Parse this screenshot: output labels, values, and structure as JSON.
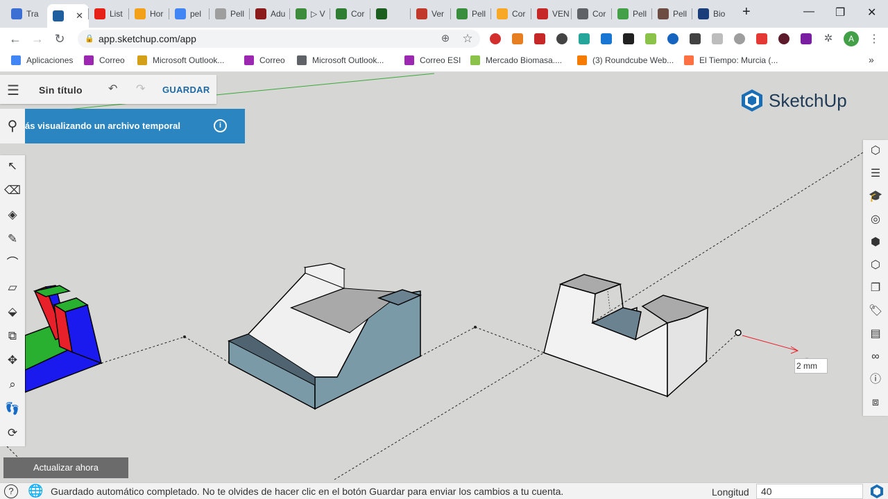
{
  "browser": {
    "tabs": [
      {
        "label": "Tra",
        "color": "#3b6fd4"
      },
      {
        "label": "",
        "color": "#1f5fa0",
        "active": true
      },
      {
        "label": "List",
        "color": "#e62117"
      },
      {
        "label": "Hor",
        "color": "#f4a11a"
      },
      {
        "label": "pel",
        "color": "#4285f4"
      },
      {
        "label": "Pell",
        "color": "#9e9e9e"
      },
      {
        "label": "Adu",
        "color": "#8b1a1a"
      },
      {
        "label": "▷ V",
        "color": "#3c8c3c"
      },
      {
        "label": "Cor",
        "color": "#2e7d32"
      },
      {
        "label": "",
        "color": "#1b5e20"
      },
      {
        "label": "Ver",
        "color": "#c0392b"
      },
      {
        "label": "Pell",
        "color": "#388e3c"
      },
      {
        "label": "Cor",
        "color": "#f9a825"
      },
      {
        "label": "VEN",
        "color": "#c62828"
      },
      {
        "label": "Cor",
        "color": "#5f6368"
      },
      {
        "label": "Pell",
        "color": "#43a047"
      },
      {
        "label": "Pell",
        "color": "#6d4c41"
      },
      {
        "label": "Bio",
        "color": "#1a3e7a"
      }
    ],
    "new_tab": "+",
    "url": "app.sketchup.com/app",
    "bookmarks": [
      {
        "label": "Aplicaciones",
        "color": "#4285f4"
      },
      {
        "label": "Correo",
        "color": "#9c27b0"
      },
      {
        "label": "Microsoft Outlook...",
        "color": "#d4a017"
      },
      {
        "label": "Correo",
        "color": "#9c27b0"
      },
      {
        "label": "Microsoft Outlook...",
        "color": "#5f6368"
      },
      {
        "label": "Correo ESI",
        "color": "#9c27b0"
      },
      {
        "label": "Mercado Biomasa....",
        "color": "#8bc34a"
      },
      {
        "label": "(3) Roundcube Web...",
        "color": "#f57c00"
      },
      {
        "label": "El Tiempo: Murcia (...",
        "color": "#ff7043"
      }
    ],
    "bookmarks_more": "»",
    "profile_initial": "A"
  },
  "app": {
    "title": "Sin título",
    "save_label": "GUARDAR",
    "banner_text": "ás visualizando un archivo temporal",
    "logo_text": "SketchUp",
    "update_label": "Actualizar ahora",
    "dimension_label": "2 mm",
    "status": {
      "message": "Guardado automático completado. No te olvides de hacer clic en el botón Guardar para enviar los cambios a tu cuenta.",
      "length_label": "Longitud",
      "length_value": "40"
    },
    "left_tools": [
      "select",
      "eraser",
      "paint",
      "pencil",
      "arc",
      "rectangle",
      "push-pull",
      "offset",
      "move",
      "tape-measure",
      "walk",
      "orbit"
    ],
    "right_tools": [
      "entity-info",
      "outliner",
      "instructor",
      "components",
      "materials",
      "styles",
      "scenes",
      "tags",
      "display",
      "views",
      "info",
      "export"
    ],
    "colors": {
      "accent": "#1f6aa5",
      "banner": "#2a85c0",
      "model_gray": "#7b9aa8",
      "red": "#e8202a",
      "green": "#2ab030",
      "blue": "#1a1aef"
    }
  }
}
